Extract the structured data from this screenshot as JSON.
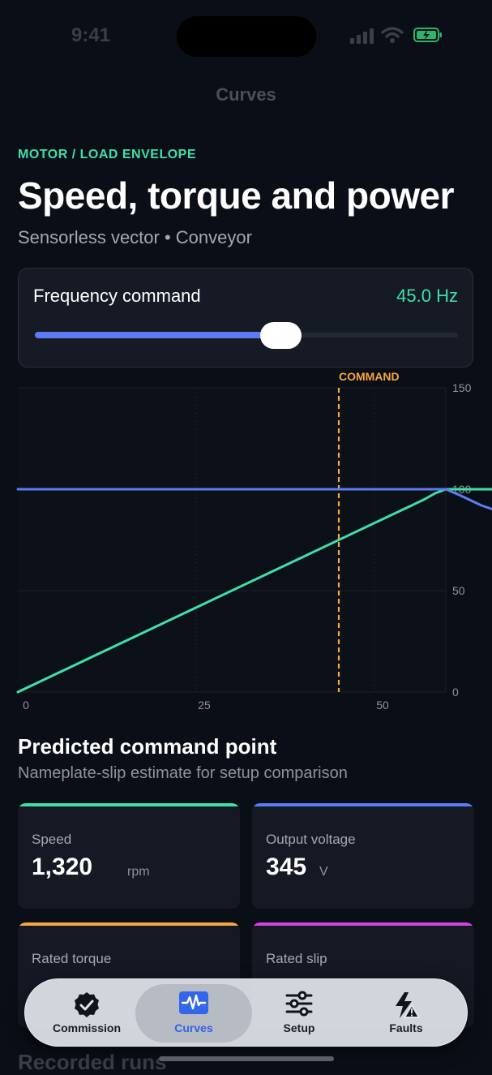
{
  "status": {
    "time": "9:41"
  },
  "nav": {
    "title": "Curves"
  },
  "header": {
    "eyebrow": "MOTOR / LOAD ENVELOPE",
    "title": "Speed, torque and power",
    "subtitle": "Sensorless vector • Conveyor"
  },
  "frequency": {
    "label": "Frequency command",
    "value_text": "45.0 Hz",
    "slider_fraction": 0.58
  },
  "chart_data": {
    "type": "line",
    "title": "",
    "xlabel": "",
    "ylabel": "",
    "xlim": [
      0,
      60
    ],
    "ylim": [
      0,
      150
    ],
    "x_ticks": [
      "0",
      "25",
      "50"
    ],
    "y_ticks": [
      "150",
      "100",
      "50",
      "0"
    ],
    "grid": true,
    "annotation": {
      "label": "COMMAND",
      "x": 45
    },
    "series": [
      {
        "color": "#3ee0a8",
        "x": [
          0,
          57,
          58.5,
          60,
          62,
          65,
          70,
          72
        ],
        "y": [
          0,
          95,
          98,
          100,
          100,
          100,
          100,
          100
        ]
      },
      {
        "color": "#5b7cf5",
        "x": [
          0,
          50,
          58,
          60,
          62,
          65,
          70,
          72
        ],
        "y": [
          100,
          100,
          100,
          100,
          97,
          92,
          86,
          83
        ]
      }
    ]
  },
  "predicted": {
    "title": "Predicted command point",
    "subtitle": "Nameplate-slip estimate for setup comparison"
  },
  "metrics": [
    {
      "label": "Speed",
      "value": "1,320",
      "unit": "rpm",
      "color": "#3ee0a8"
    },
    {
      "label": "Output voltage",
      "value": "345",
      "unit": "V",
      "color": "#5b7cf5"
    },
    {
      "label": "Rated torque",
      "value": "",
      "unit": "",
      "color": "#f5a742"
    },
    {
      "label": "Rated slip",
      "value": "",
      "unit": "",
      "color": "#d046e0"
    }
  ],
  "recorded": {
    "title": "Recorded runs"
  },
  "tabs": [
    {
      "label": "Commission",
      "icon": "check-badge-icon",
      "active": false
    },
    {
      "label": "Curves",
      "icon": "waveform-icon",
      "active": true
    },
    {
      "label": "Setup",
      "icon": "sliders-icon",
      "active": false
    },
    {
      "label": "Faults",
      "icon": "bolt-warning-icon",
      "active": false
    }
  ]
}
